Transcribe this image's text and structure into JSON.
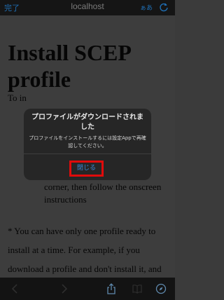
{
  "browser": {
    "done_label": "完了",
    "url": "localhost",
    "text_size_label": "ぁあ",
    "reload_icon": "reload-icon"
  },
  "page": {
    "title": "Install SCEP profile",
    "partial_text_1": "To in",
    "partial_text_2": "corner, then follow the onscreen instructions",
    "note": "* You can have only one profile ready to install at a time. For example, if you download a profile and don't install it, and then"
  },
  "alert": {
    "title": "プロファイルがダウンロードされました",
    "message": "プロファイルをインストールするには設定Appで再確認してください。",
    "close_label": "閉じる"
  },
  "toolbar": {
    "back_icon": "back-icon",
    "forward_icon": "forward-icon",
    "share_icon": "share-icon",
    "bookmarks_icon": "bookmarks-icon",
    "compass_icon": "compass-icon"
  },
  "colors": {
    "accent": "#3a8bdc",
    "highlight": "#e00b0b",
    "dim_background": "#3d3d3d"
  }
}
